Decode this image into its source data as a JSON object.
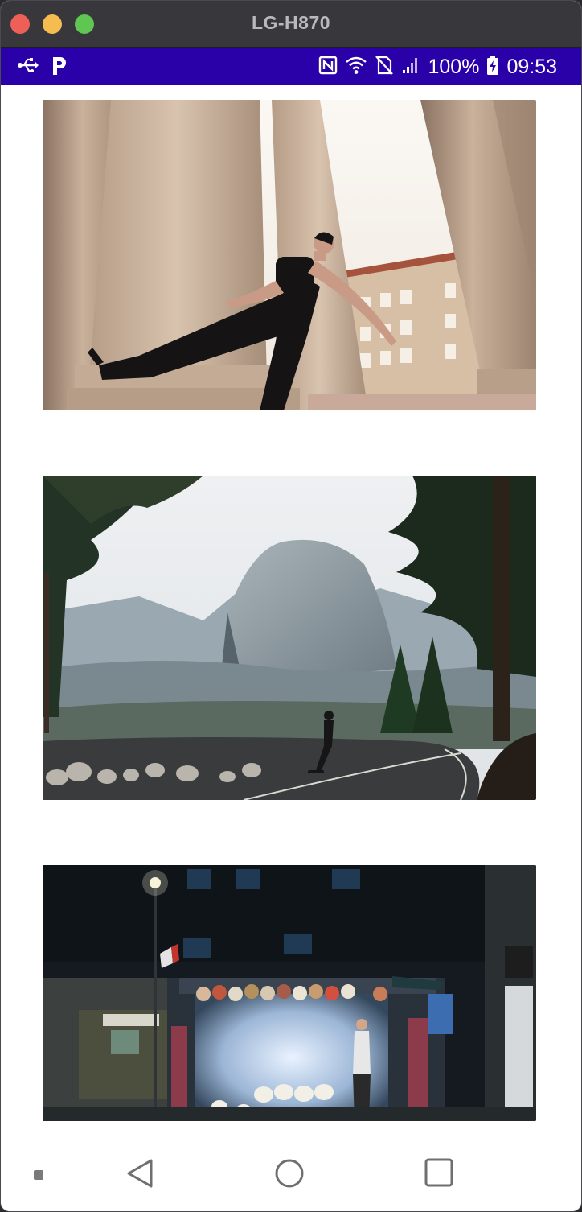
{
  "window": {
    "title": "LG-H870"
  },
  "status_bar": {
    "left_icons": [
      "usb-icon",
      "parking-app-icon"
    ],
    "right_icons": [
      "nfc-icon",
      "wifi-icon",
      "no-sim-icon",
      "signal-icon",
      "battery-charging-icon"
    ],
    "battery": "100%",
    "time": "09:53",
    "background_color": "#2a00a8"
  },
  "feed": {
    "images": [
      {
        "name": "photo-woman-columns"
      },
      {
        "name": "photo-half-dome-skater"
      },
      {
        "name": "photo-night-kiosk"
      }
    ]
  },
  "nav_bar": {
    "buttons": [
      "notification-dot",
      "back-button",
      "home-button",
      "recents-button"
    ]
  }
}
